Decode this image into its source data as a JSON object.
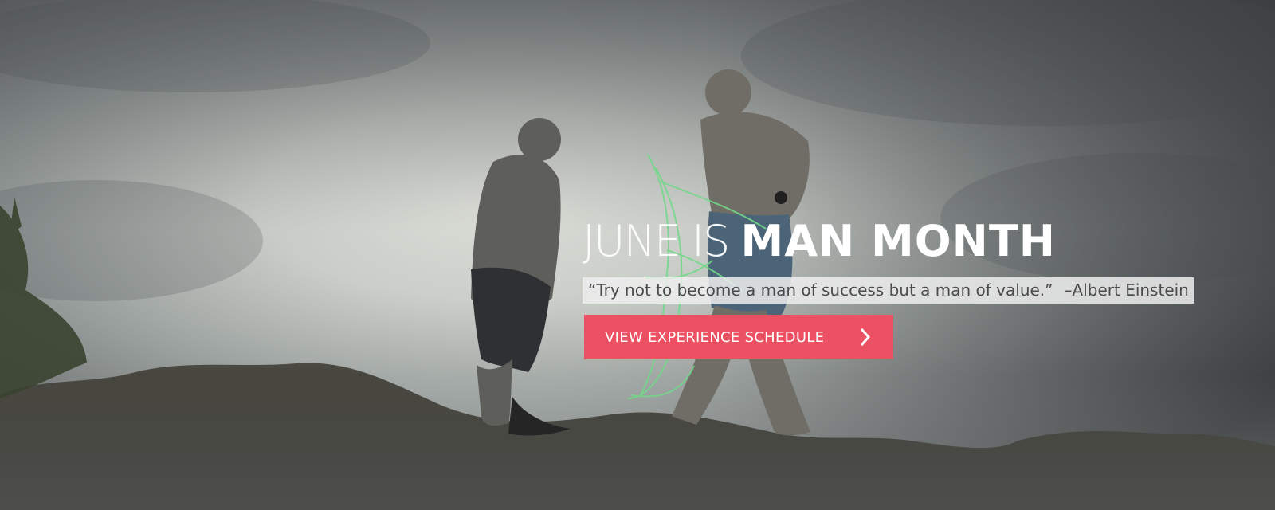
{
  "hero": {
    "headline_light": "JUNE IS ",
    "headline_bold": "MAN MONTH",
    "quote_text": "“Try not to become a man of success but a man of value.”",
    "quote_author": "–Albert Einstein",
    "cta_label": "VIEW EXPERIENCE SCHEDULE",
    "cta_icon": "chevron-right-icon",
    "image_description": "Two men standing on dark coastal rocks under a stormy cloudy sky, one holding a green fishing net"
  },
  "colors": {
    "cta_background": "#eb5163",
    "headline_text": "#ffffff",
    "quote_background": "#eeeeee",
    "quote_text": "#4b4b4b"
  }
}
